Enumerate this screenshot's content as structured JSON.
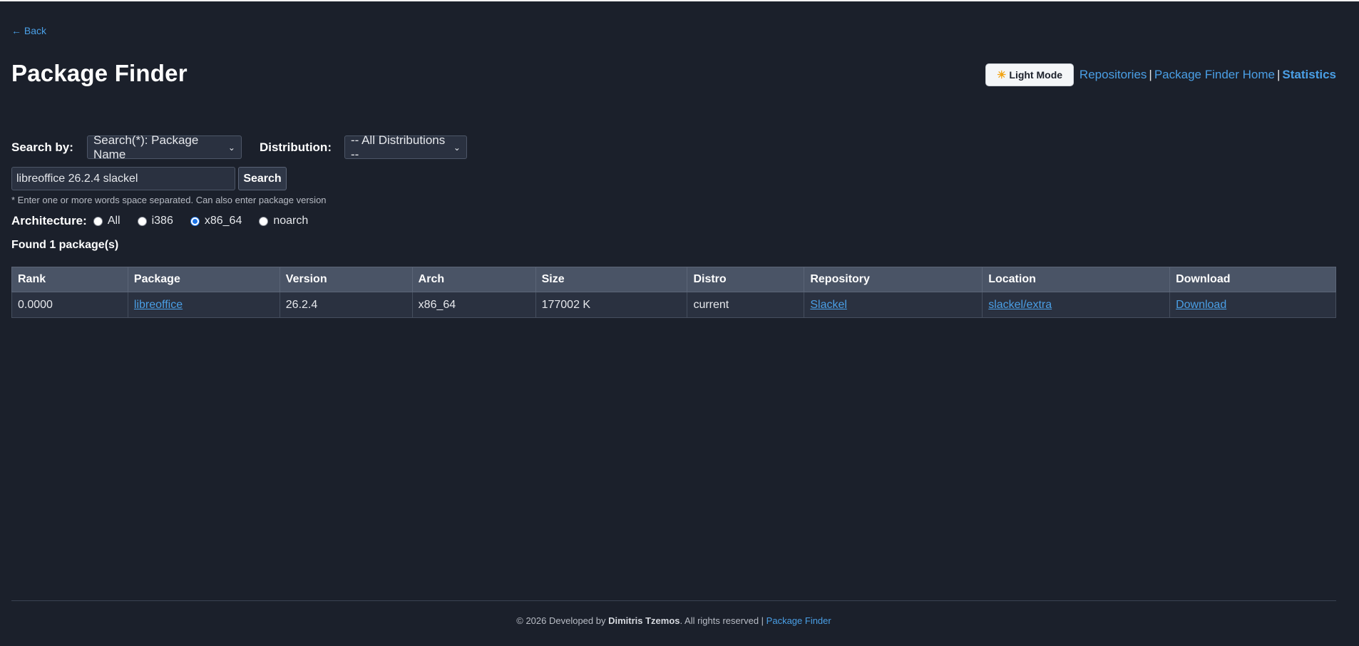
{
  "nav": {
    "back_label": "← Back",
    "theme_button_icon": "sun-icon",
    "theme_button_label": "Light Mode",
    "links": [
      {
        "label": "Repositories"
      },
      {
        "label": "Package Finder Home"
      },
      {
        "label": "Statistics"
      }
    ],
    "separator": "|"
  },
  "page_title": "Package Finder",
  "search": {
    "search_by_label": "Search by:",
    "search_by_value": "Search(*): Package Name",
    "distribution_label": "Distribution:",
    "distribution_value": "-- All Distributions --",
    "query_value": "libreoffice 26.2.4 slackel",
    "search_button": "Search",
    "hint": "* Enter one or more words space separated. Can also enter package version"
  },
  "architecture": {
    "label": "Architecture:",
    "options": [
      {
        "label": "All",
        "checked": false
      },
      {
        "label": "i386",
        "checked": false
      },
      {
        "label": "x86_64",
        "checked": true
      },
      {
        "label": "noarch",
        "checked": false
      }
    ]
  },
  "found_text": "Found 1 package(s)",
  "table": {
    "headers": [
      "Rank",
      "Package",
      "Version",
      "Arch",
      "Size",
      "Distro",
      "Repository",
      "Location",
      "Download"
    ],
    "rows": [
      {
        "rank": "0.0000",
        "package": "libreoffice",
        "version": "26.2.4",
        "arch": "x86_64",
        "size": "177002 K",
        "distro": "current",
        "repository": "Slackel",
        "location": "slackel/extra",
        "download": "Download"
      }
    ]
  },
  "footer": {
    "prefix": "© 2026 Developed by ",
    "author": "Dimitris Tzemos",
    "middle": ". All rights reserved | ",
    "link": "Package Finder"
  },
  "colors": {
    "background": "#1b202b",
    "link": "#4a9fe6",
    "table_header": "#4a5466",
    "table_cell": "#2a3140"
  }
}
